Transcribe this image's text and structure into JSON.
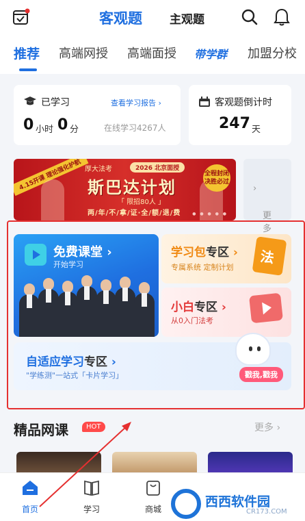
{
  "header": {
    "title": "客观题",
    "alt_title": "主观题",
    "icons": {
      "calendar": "calendar-check-icon",
      "search": "search-icon",
      "bell": "bell-icon"
    }
  },
  "tabs": [
    "推荐",
    "高端网授",
    "高端面授",
    "带学群",
    "加盟分校"
  ],
  "study_card": {
    "label": "已学习",
    "report_link": "查看学习报告",
    "hours": "0",
    "hours_unit": "小时",
    "minutes": "0",
    "minutes_unit": "分",
    "online": "在线学习4267人"
  },
  "countdown_card": {
    "label": "客观题倒计时",
    "days": "247",
    "days_unit": "天"
  },
  "banner": {
    "ribbon": "4.15开课 理论强化护航",
    "brand": "厚大法考",
    "year_tag": "2026 北京面授",
    "headline": "斯巴达计划",
    "quota": "「 限招80人 」",
    "tagline": "两/年/不/拿/证·全/额/退/费",
    "stamp": "全程封闭 决胜必过"
  },
  "more_label": "更多",
  "free_class": {
    "title": "免费课堂",
    "subtitle": "开始学习"
  },
  "study_pack": {
    "title_a": "学习包",
    "title_b": "专区",
    "subtitle": "专属系统  定制计划",
    "book_char": "法"
  },
  "newbie": {
    "title_a": "小白",
    "title_b": "专区",
    "subtitle": "从0入门法考"
  },
  "adaptive": {
    "title_a": "自适应学习",
    "title_b": "专区",
    "subtitle": "\"学练测\"一站式「卡片学习」",
    "poke": "戳我,戳我"
  },
  "premium": {
    "title": "精品网课",
    "badge": "HOT",
    "more": "更多"
  },
  "bottom_nav": [
    {
      "label": "首页",
      "icon": "home-icon",
      "active": true
    },
    {
      "label": "学习",
      "icon": "book-icon",
      "active": false
    },
    {
      "label": "商城",
      "icon": "shop-icon",
      "active": false
    }
  ],
  "watermark": {
    "text": "西西软件园",
    "url": "CR173.COM"
  },
  "colors": {
    "accent": "#1f6fe0",
    "highlight": "#e53030"
  }
}
